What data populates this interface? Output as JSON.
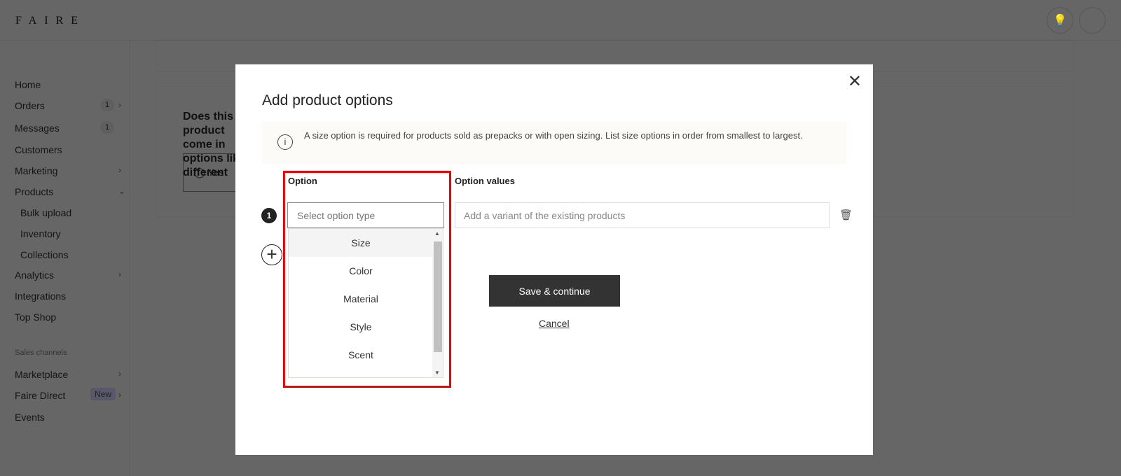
{
  "header": {
    "logo": "FAIRE"
  },
  "sidebar": {
    "items": [
      {
        "label": "Home"
      },
      {
        "label": "Orders",
        "count": "1"
      },
      {
        "label": "Messages",
        "count": "1"
      },
      {
        "label": "Customers"
      },
      {
        "label": "Marketing"
      },
      {
        "label": "Products"
      },
      {
        "label": "Bulk upload"
      },
      {
        "label": "Inventory"
      },
      {
        "label": "Collections"
      },
      {
        "label": "Analytics"
      },
      {
        "label": "Integrations"
      },
      {
        "label": "Top Shop"
      }
    ],
    "section": "Sales channels",
    "channels": [
      {
        "label": "Marketplace"
      },
      {
        "label": "Faire Direct",
        "badge": "New"
      },
      {
        "label": "Events"
      }
    ]
  },
  "background": {
    "question": "Does this product come in options like different",
    "radio_yes": "Yes"
  },
  "modal": {
    "title": "Add product options",
    "info": "A size option is required for products sold as prepacks or with open sizing. List size options in order from smallest to largest.",
    "option_label": "Option",
    "values_label": "Option values",
    "row_number": "1",
    "select_placeholder": "Select option type",
    "values_placeholder": "Add a variant of the existing products",
    "options": [
      "Size",
      "Color",
      "Material",
      "Style",
      "Scent"
    ],
    "save": "Save & continue",
    "cancel": "Cancel"
  }
}
